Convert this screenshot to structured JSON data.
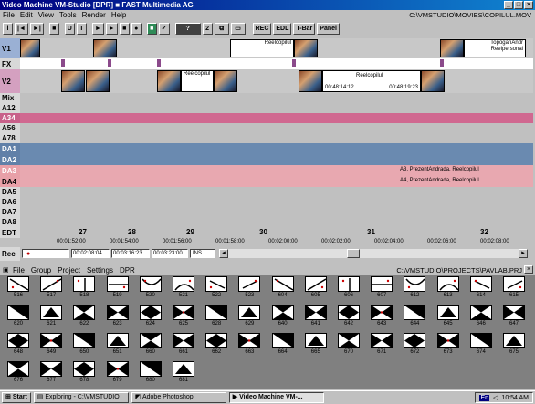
{
  "window": {
    "title": "Video Machine   VM-Studio  [DPR]  ■  FAST Multimedia AG",
    "menus": [
      "File",
      "Edit",
      "View",
      "Tools",
      "Render",
      "Help"
    ],
    "path": "C:\\VMSTUDIO\\MOVIES\\COPILUL.MOV"
  },
  "toolbar": {
    "buttons": [
      "i",
      "|◄",
      "►|",
      "■",
      "U",
      "I",
      "►",
      "►",
      "■",
      "●",
      "■",
      "✓",
      "?",
      "2",
      "REC",
      "EDL",
      "T-Bar",
      "Panel"
    ]
  },
  "timeline": {
    "tracks": [
      "V1",
      "FX",
      "V2",
      "Mix",
      "A12",
      "A34",
      "A56",
      "A78",
      "DA1",
      "DA2",
      "DA3",
      "DA4",
      "DA5",
      "DA6",
      "DA7",
      "DA8",
      "EDT",
      "Rec"
    ],
    "clips": {
      "v1_a": "Reelcopilul",
      "v1_b": "TopoganAndr",
      "v1_c": "Reelpersonal",
      "v2_a": "Reelcopilul",
      "v2_b": "Reelcopilul",
      "v2_tc1": "00:48:14:12",
      "v2_tc2": "00:48:19:23",
      "da3": "A3, PrezentAndrada, Reelcopilul",
      "da4": "A4, PrezentAndrada, Reelcopilul"
    },
    "ruler_numbers": [
      "27",
      "28",
      "29",
      "30",
      "31",
      "32"
    ],
    "timecodes": [
      "00:01:52:00",
      "00:01:54:00",
      "00:01:56:00",
      "00:01:58:00",
      "00:02:00:00",
      "00:02:02:00",
      "00:02:04:00",
      "00:02:06:00",
      "00:02:08:00"
    ],
    "rec": {
      "in": "00:02:08:04",
      "out": "00:03:16:23",
      "dur": "00:03:23:00",
      "mode": "INS"
    }
  },
  "projects": {
    "menus": [
      "File",
      "Group",
      "Project",
      "Settings",
      "DPR"
    ],
    "path": "C:\\VMSTUDIO\\PROJECTS\\PAVLAB.PRJ",
    "effects": [
      [
        "516",
        "517",
        "518",
        "519",
        "520",
        "521",
        "522",
        "523",
        "604",
        "605",
        "606",
        "607",
        "612",
        "613",
        "614",
        "615"
      ],
      [
        "620",
        "621",
        "622",
        "623",
        "624",
        "625",
        "628",
        "629",
        "640",
        "641",
        "642",
        "643",
        "644",
        "645",
        "646",
        "647"
      ],
      [
        "648",
        "649",
        "650",
        "651",
        "660",
        "661",
        "662",
        "663",
        "664",
        "665",
        "670",
        "671",
        "672",
        "673",
        "674",
        "675"
      ],
      [
        "676",
        "677",
        "678",
        "679",
        "680",
        "681"
      ]
    ]
  },
  "taskbar": {
    "start": "Start",
    "tasks": [
      "Exploring - C:\\VMSTUDIO",
      "Adobe Photoshop",
      "Video Machine   VM-..."
    ],
    "lang": "En",
    "time": "10:54 AM"
  }
}
